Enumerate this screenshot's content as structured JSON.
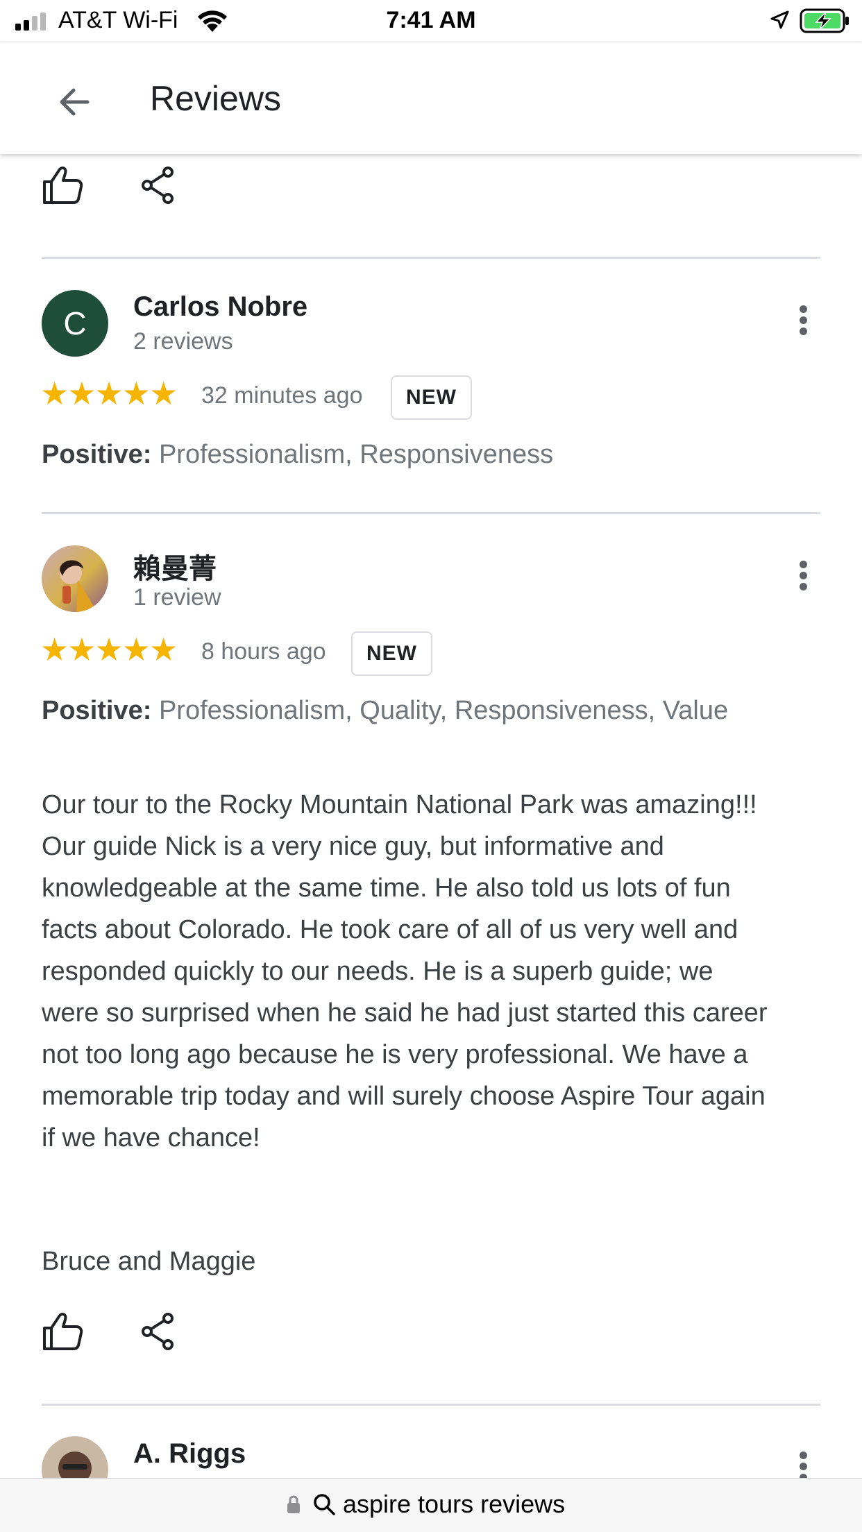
{
  "status_bar": {
    "carrier": "AT&T Wi-Fi",
    "time": "7:41 AM"
  },
  "header": {
    "title": "Reviews"
  },
  "reviews": [
    {
      "name": "Carlos Nobre",
      "avatar_letter": "C",
      "review_count": "2 reviews",
      "stars": "★★★★★",
      "rating": 5,
      "time": "32 minutes ago",
      "badge": "NEW",
      "positive_label": "Positive:",
      "positive_text": " Professionalism, Responsiveness"
    },
    {
      "name": "賴曼菁",
      "review_count": "1 review",
      "stars": "★★★★★",
      "rating": 5,
      "time": "8 hours ago",
      "badge": "NEW",
      "positive_label": "Positive:",
      "positive_text": " Professionalism, Quality, Responsiveness, Value",
      "text": "Our tour to the Rocky Mountain National Park was amazing!!! Our guide Nick is a very nice guy, but informative and knowledgeable at the same time. He also told us lots of fun facts about Colorado. He took care of all of us very well and responded quickly to our needs. He is a superb guide; we were so surprised when he said he had just started this career not too long ago because he is very professional. We have a memorable trip today and will surely choose Aspire Tour again if we have chance!",
      "signature": "Bruce and Maggie"
    },
    {
      "name": "A. Riggs"
    }
  ],
  "url_bar": {
    "text": "aspire tours reviews"
  },
  "colors": {
    "star": "#f4b400",
    "avatar_green": "#1e4d3a",
    "battery": "#4cd964"
  },
  "icons": [
    "signal-icon",
    "wifi-icon",
    "location-arrow-icon",
    "battery-icon",
    "back-arrow-icon",
    "thumbs-up-icon",
    "share-icon",
    "more-vert-icon",
    "lock-icon",
    "search-icon"
  ]
}
